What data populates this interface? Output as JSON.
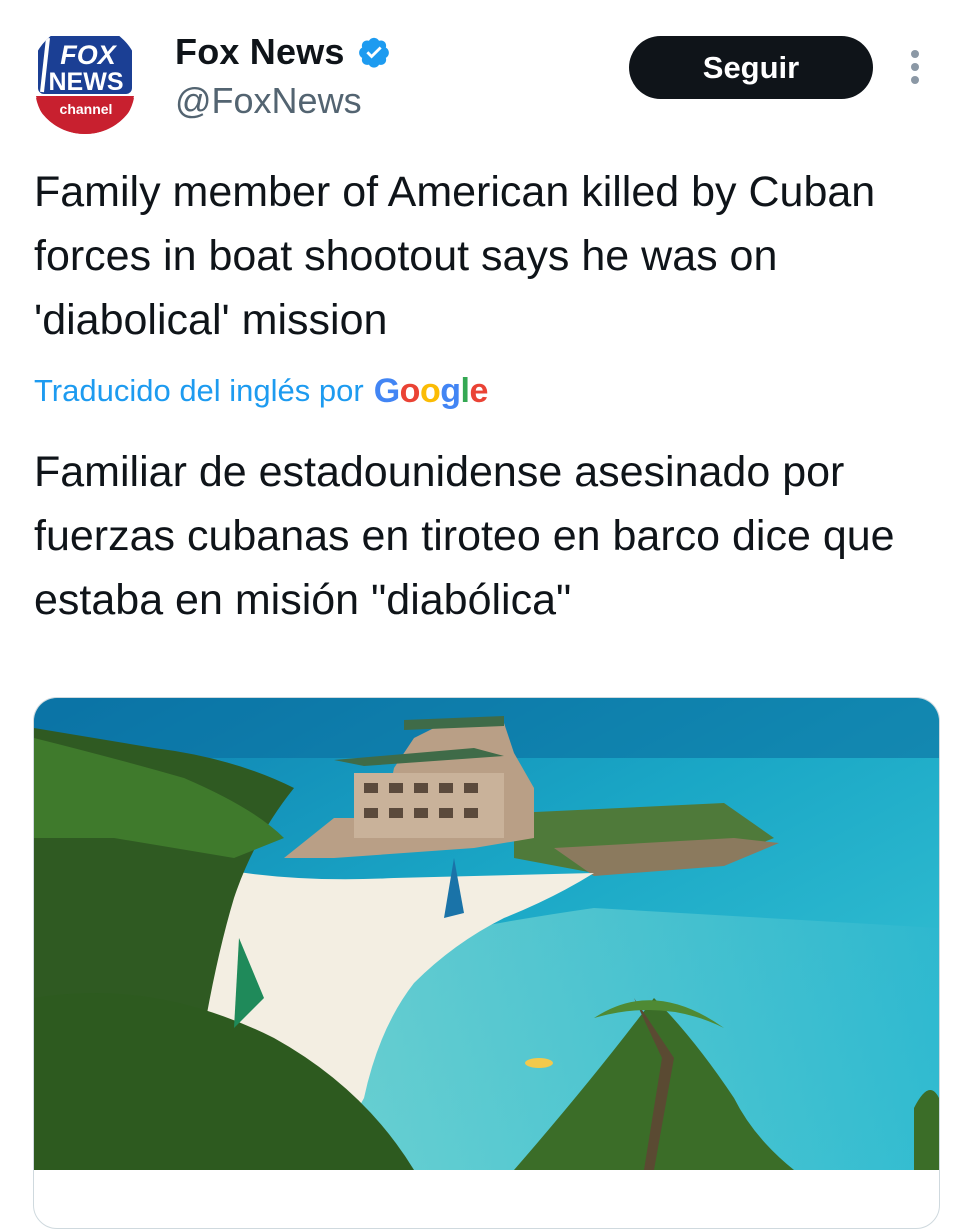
{
  "author": {
    "display_name": "Fox News",
    "handle": "@FoxNews",
    "verified_icon": "verified-badge-icon",
    "avatar_logo": {
      "line1": "FOX",
      "line2": "NEWS",
      "line3": "channel"
    }
  },
  "actions": {
    "follow_label": "Seguir",
    "more_icon": "more-vertical-icon"
  },
  "tweet": {
    "text": "Family member of American killed by Cuban forces in boat shootout says he was on 'diabolical' mission",
    "translation_note": "Traducido del inglés por",
    "translator_logo": {
      "l1": "G",
      "l2": "o",
      "l3": "o",
      "l4": "g",
      "l5": "l",
      "l6": "e"
    },
    "translated_text": "Familiar de estadounidense asesinado por fuerzas cubanas en tiroteo en barco dice que estaba en misión \"diabólica\""
  },
  "media": {
    "image_subject": "tropical beach resort with palm trees and turquoise sea"
  },
  "colors": {
    "accent": "#1d9bf0",
    "text": "#0f1419",
    "secondary_text": "#536471",
    "button_bg": "#0f1419",
    "fox_red": "#c8202f",
    "fox_blue": "#1b3f94"
  }
}
